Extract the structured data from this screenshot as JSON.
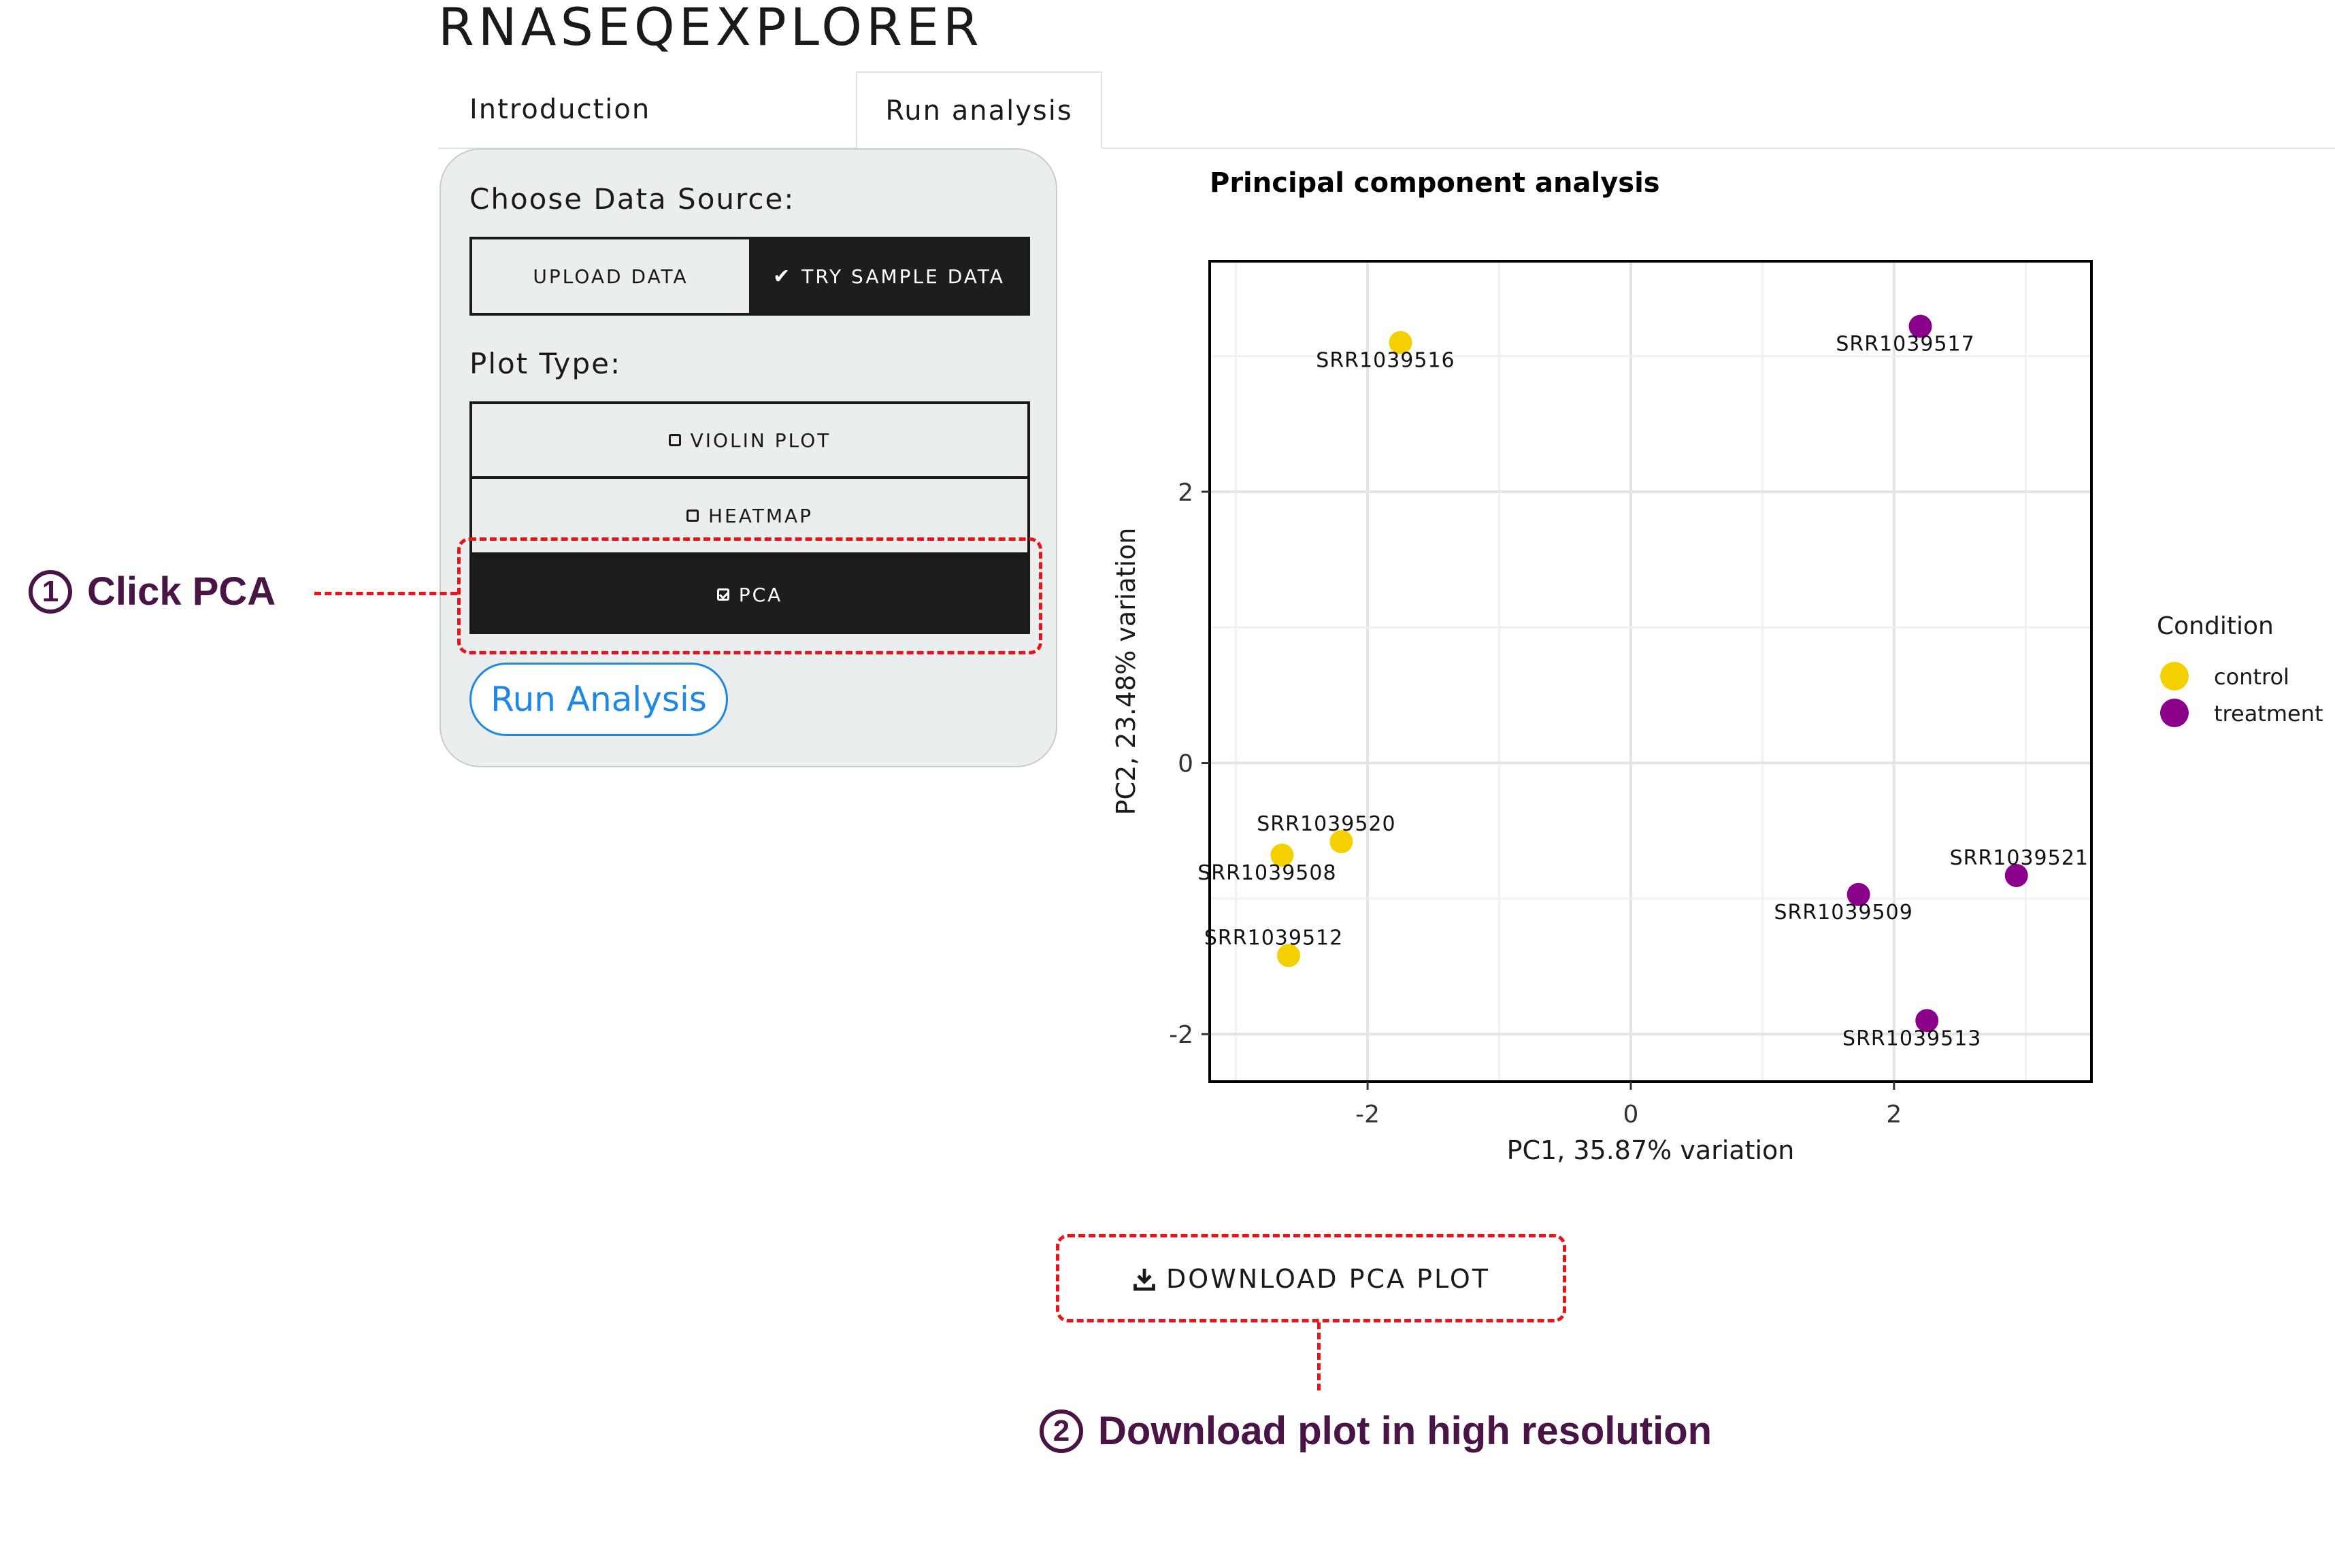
{
  "app": {
    "title": "RNASEQEXPLORER"
  },
  "tabs": [
    {
      "label": "Introduction",
      "active": false
    },
    {
      "label": "Run analysis",
      "active": true
    }
  ],
  "sidebar": {
    "data_source_label": "Choose Data Source:",
    "data_source_options": [
      {
        "label": "UPLOAD DATA",
        "selected": false
      },
      {
        "label": "TRY SAMPLE DATA",
        "selected": true,
        "icon": "check-icon"
      }
    ],
    "plot_type_label": "Plot Type:",
    "plot_types": [
      {
        "label": "VIOLIN PLOT",
        "checked": false
      },
      {
        "label": "HEATMAP",
        "checked": false
      },
      {
        "label": "PCA",
        "checked": true
      }
    ],
    "run_button": "Run Analysis"
  },
  "chart_data": {
    "type": "scatter",
    "title": "Principal component analysis",
    "xlabel": "PC1, 35.87% variation",
    "ylabel": "PC2, 23.48% variation",
    "xlim": [
      -3.2,
      3.5
    ],
    "ylim": [
      -2.35,
      3.7
    ],
    "x_ticks": [
      -2,
      0,
      2
    ],
    "x_tick_labels": [
      "-2",
      "0",
      "2"
    ],
    "y_ticks": [
      -2,
      0,
      2
    ],
    "y_tick_labels": [
      "-2",
      "0",
      "2"
    ],
    "grid": true,
    "legend": {
      "title": "Condition",
      "placement": "right",
      "entries": [
        {
          "label": "control",
          "color": "#f5d000"
        },
        {
          "label": "treatment",
          "color": "#8b008b"
        }
      ]
    },
    "points": [
      {
        "label": "SRR1039516",
        "x": -1.75,
        "y": 3.1,
        "group": "control"
      },
      {
        "label": "SRR1039517",
        "x": 2.2,
        "y": 3.22,
        "group": "treatment"
      },
      {
        "label": "SRR1039520",
        "x": -2.2,
        "y": -0.58,
        "group": "control"
      },
      {
        "label": "SRR1039508",
        "x": -2.65,
        "y": -0.68,
        "group": "control"
      },
      {
        "label": "SRR1039512",
        "x": -2.6,
        "y": -1.42,
        "group": "control"
      },
      {
        "label": "SRR1039509",
        "x": 1.73,
        "y": -0.97,
        "group": "treatment"
      },
      {
        "label": "SRR1039521",
        "x": 2.93,
        "y": -0.83,
        "group": "treatment"
      },
      {
        "label": "SRR1039513",
        "x": 2.25,
        "y": -1.9,
        "group": "treatment"
      }
    ]
  },
  "download_button": "DOWNLOAD PCA PLOT",
  "annotations": {
    "step1_number": "1",
    "step1_text": "Click PCA",
    "step2_number": "2",
    "step2_text": "Download plot in high resolution",
    "highlight_color": "#e8141a",
    "annotation_color": "#4a1446"
  }
}
